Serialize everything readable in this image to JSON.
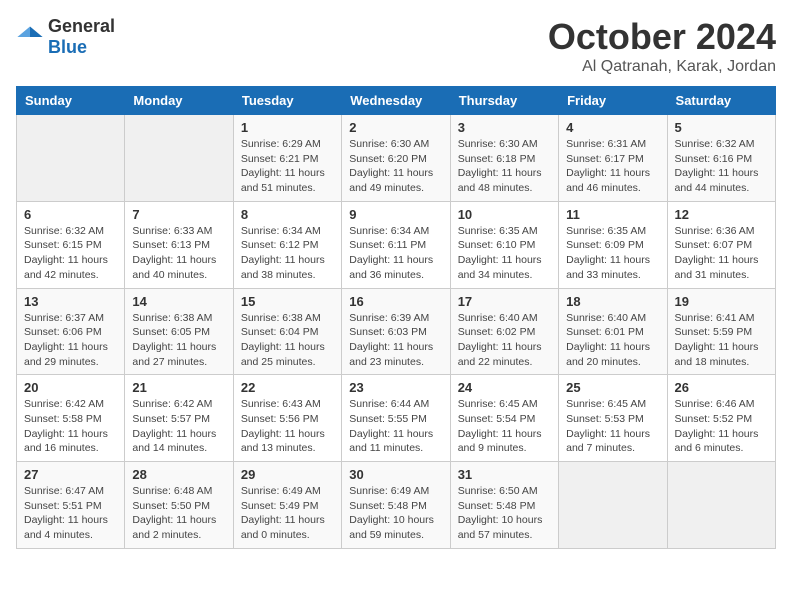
{
  "logo": {
    "general": "General",
    "blue": "Blue"
  },
  "header": {
    "month": "October 2024",
    "location": "Al Qatranah, Karak, Jordan"
  },
  "weekdays": [
    "Sunday",
    "Monday",
    "Tuesday",
    "Wednesday",
    "Thursday",
    "Friday",
    "Saturday"
  ],
  "weeks": [
    [
      {
        "day": "",
        "sunrise": "",
        "sunset": "",
        "daylight": ""
      },
      {
        "day": "",
        "sunrise": "",
        "sunset": "",
        "daylight": ""
      },
      {
        "day": "1",
        "sunrise": "Sunrise: 6:29 AM",
        "sunset": "Sunset: 6:21 PM",
        "daylight": "Daylight: 11 hours and 51 minutes."
      },
      {
        "day": "2",
        "sunrise": "Sunrise: 6:30 AM",
        "sunset": "Sunset: 6:20 PM",
        "daylight": "Daylight: 11 hours and 49 minutes."
      },
      {
        "day": "3",
        "sunrise": "Sunrise: 6:30 AM",
        "sunset": "Sunset: 6:18 PM",
        "daylight": "Daylight: 11 hours and 48 minutes."
      },
      {
        "day": "4",
        "sunrise": "Sunrise: 6:31 AM",
        "sunset": "Sunset: 6:17 PM",
        "daylight": "Daylight: 11 hours and 46 minutes."
      },
      {
        "day": "5",
        "sunrise": "Sunrise: 6:32 AM",
        "sunset": "Sunset: 6:16 PM",
        "daylight": "Daylight: 11 hours and 44 minutes."
      }
    ],
    [
      {
        "day": "6",
        "sunrise": "Sunrise: 6:32 AM",
        "sunset": "Sunset: 6:15 PM",
        "daylight": "Daylight: 11 hours and 42 minutes."
      },
      {
        "day": "7",
        "sunrise": "Sunrise: 6:33 AM",
        "sunset": "Sunset: 6:13 PM",
        "daylight": "Daylight: 11 hours and 40 minutes."
      },
      {
        "day": "8",
        "sunrise": "Sunrise: 6:34 AM",
        "sunset": "Sunset: 6:12 PM",
        "daylight": "Daylight: 11 hours and 38 minutes."
      },
      {
        "day": "9",
        "sunrise": "Sunrise: 6:34 AM",
        "sunset": "Sunset: 6:11 PM",
        "daylight": "Daylight: 11 hours and 36 minutes."
      },
      {
        "day": "10",
        "sunrise": "Sunrise: 6:35 AM",
        "sunset": "Sunset: 6:10 PM",
        "daylight": "Daylight: 11 hours and 34 minutes."
      },
      {
        "day": "11",
        "sunrise": "Sunrise: 6:35 AM",
        "sunset": "Sunset: 6:09 PM",
        "daylight": "Daylight: 11 hours and 33 minutes."
      },
      {
        "day": "12",
        "sunrise": "Sunrise: 6:36 AM",
        "sunset": "Sunset: 6:07 PM",
        "daylight": "Daylight: 11 hours and 31 minutes."
      }
    ],
    [
      {
        "day": "13",
        "sunrise": "Sunrise: 6:37 AM",
        "sunset": "Sunset: 6:06 PM",
        "daylight": "Daylight: 11 hours and 29 minutes."
      },
      {
        "day": "14",
        "sunrise": "Sunrise: 6:38 AM",
        "sunset": "Sunset: 6:05 PM",
        "daylight": "Daylight: 11 hours and 27 minutes."
      },
      {
        "day": "15",
        "sunrise": "Sunrise: 6:38 AM",
        "sunset": "Sunset: 6:04 PM",
        "daylight": "Daylight: 11 hours and 25 minutes."
      },
      {
        "day": "16",
        "sunrise": "Sunrise: 6:39 AM",
        "sunset": "Sunset: 6:03 PM",
        "daylight": "Daylight: 11 hours and 23 minutes."
      },
      {
        "day": "17",
        "sunrise": "Sunrise: 6:40 AM",
        "sunset": "Sunset: 6:02 PM",
        "daylight": "Daylight: 11 hours and 22 minutes."
      },
      {
        "day": "18",
        "sunrise": "Sunrise: 6:40 AM",
        "sunset": "Sunset: 6:01 PM",
        "daylight": "Daylight: 11 hours and 20 minutes."
      },
      {
        "day": "19",
        "sunrise": "Sunrise: 6:41 AM",
        "sunset": "Sunset: 5:59 PM",
        "daylight": "Daylight: 11 hours and 18 minutes."
      }
    ],
    [
      {
        "day": "20",
        "sunrise": "Sunrise: 6:42 AM",
        "sunset": "Sunset: 5:58 PM",
        "daylight": "Daylight: 11 hours and 16 minutes."
      },
      {
        "day": "21",
        "sunrise": "Sunrise: 6:42 AM",
        "sunset": "Sunset: 5:57 PM",
        "daylight": "Daylight: 11 hours and 14 minutes."
      },
      {
        "day": "22",
        "sunrise": "Sunrise: 6:43 AM",
        "sunset": "Sunset: 5:56 PM",
        "daylight": "Daylight: 11 hours and 13 minutes."
      },
      {
        "day": "23",
        "sunrise": "Sunrise: 6:44 AM",
        "sunset": "Sunset: 5:55 PM",
        "daylight": "Daylight: 11 hours and 11 minutes."
      },
      {
        "day": "24",
        "sunrise": "Sunrise: 6:45 AM",
        "sunset": "Sunset: 5:54 PM",
        "daylight": "Daylight: 11 hours and 9 minutes."
      },
      {
        "day": "25",
        "sunrise": "Sunrise: 6:45 AM",
        "sunset": "Sunset: 5:53 PM",
        "daylight": "Daylight: 11 hours and 7 minutes."
      },
      {
        "day": "26",
        "sunrise": "Sunrise: 6:46 AM",
        "sunset": "Sunset: 5:52 PM",
        "daylight": "Daylight: 11 hours and 6 minutes."
      }
    ],
    [
      {
        "day": "27",
        "sunrise": "Sunrise: 6:47 AM",
        "sunset": "Sunset: 5:51 PM",
        "daylight": "Daylight: 11 hours and 4 minutes."
      },
      {
        "day": "28",
        "sunrise": "Sunrise: 6:48 AM",
        "sunset": "Sunset: 5:50 PM",
        "daylight": "Daylight: 11 hours and 2 minutes."
      },
      {
        "day": "29",
        "sunrise": "Sunrise: 6:49 AM",
        "sunset": "Sunset: 5:49 PM",
        "daylight": "Daylight: 11 hours and 0 minutes."
      },
      {
        "day": "30",
        "sunrise": "Sunrise: 6:49 AM",
        "sunset": "Sunset: 5:48 PM",
        "daylight": "Daylight: 10 hours and 59 minutes."
      },
      {
        "day": "31",
        "sunrise": "Sunrise: 6:50 AM",
        "sunset": "Sunset: 5:48 PM",
        "daylight": "Daylight: 10 hours and 57 minutes."
      },
      {
        "day": "",
        "sunrise": "",
        "sunset": "",
        "daylight": ""
      },
      {
        "day": "",
        "sunrise": "",
        "sunset": "",
        "daylight": ""
      }
    ]
  ]
}
